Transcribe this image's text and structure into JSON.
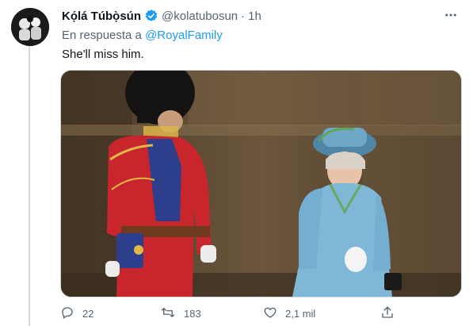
{
  "tweet": {
    "author_name": "Kọ́lá Túbọ̀sún",
    "author_handle": "@kolatubosun",
    "separator": "·",
    "time": "1h",
    "reply_prefix": "En respuesta a",
    "reply_to": "@RoyalFamily",
    "text": "She'll miss him."
  },
  "media": {
    "description_icon": "photo",
    "colors": {
      "background": "#5b4a36",
      "guard_tunic": "#c8262c",
      "queen_outfit": "#7fb7d6"
    }
  },
  "actions": {
    "replies": "22",
    "retweets": "183",
    "likes": "2,1 mil"
  },
  "icons": {
    "verified": "verified-badge-icon",
    "more": "more-options-icon",
    "reply": "reply-icon",
    "retweet": "retweet-icon",
    "like": "heart-icon",
    "share": "share-icon"
  },
  "colors": {
    "accent": "#1d9bf0",
    "muted": "#536471",
    "text": "#0f1419"
  }
}
